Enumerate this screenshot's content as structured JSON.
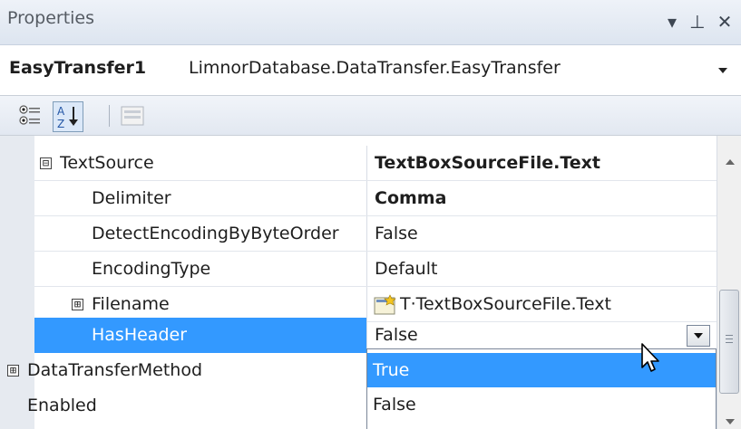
{
  "titlebar": {
    "title": "Properties",
    "buttons": [
      "▾",
      "⊥",
      "✕"
    ]
  },
  "object_selector": {
    "name": "EasyTransfer1",
    "type": "LimnorDatabase.DataTransfer.EasyTransfer"
  },
  "toolbar": {
    "categorized_icon": "categorized-icon",
    "alphabetical_icon": "alphabetical-icon",
    "property_pages_icon": "property-pages-icon"
  },
  "grid": {
    "rows": [
      {
        "label": "TextSource",
        "value": "TextBoxSourceFile.Text",
        "expander": "⊟",
        "value_bold": true
      },
      {
        "label": "Delimiter",
        "value": "Comma",
        "value_bold": true
      },
      {
        "label": "DetectEncodingByByteOrder",
        "value": "False"
      },
      {
        "label": "EncodingType",
        "value": "Default"
      },
      {
        "label": "Filename",
        "value": "T·TextBoxSourceFile.Text",
        "expander": "⊞"
      },
      {
        "label": "HasHeader",
        "value": "False",
        "selected": true
      },
      {
        "label": "DataTransferMethod",
        "value": "",
        "expander": "⊞"
      },
      {
        "label": "Enabled",
        "value": ""
      }
    ]
  },
  "dropdown": {
    "options": [
      "True",
      "False"
    ],
    "highlighted": "True"
  },
  "colors": {
    "selection": "#3399ff",
    "margin": "#e6eaf0"
  }
}
